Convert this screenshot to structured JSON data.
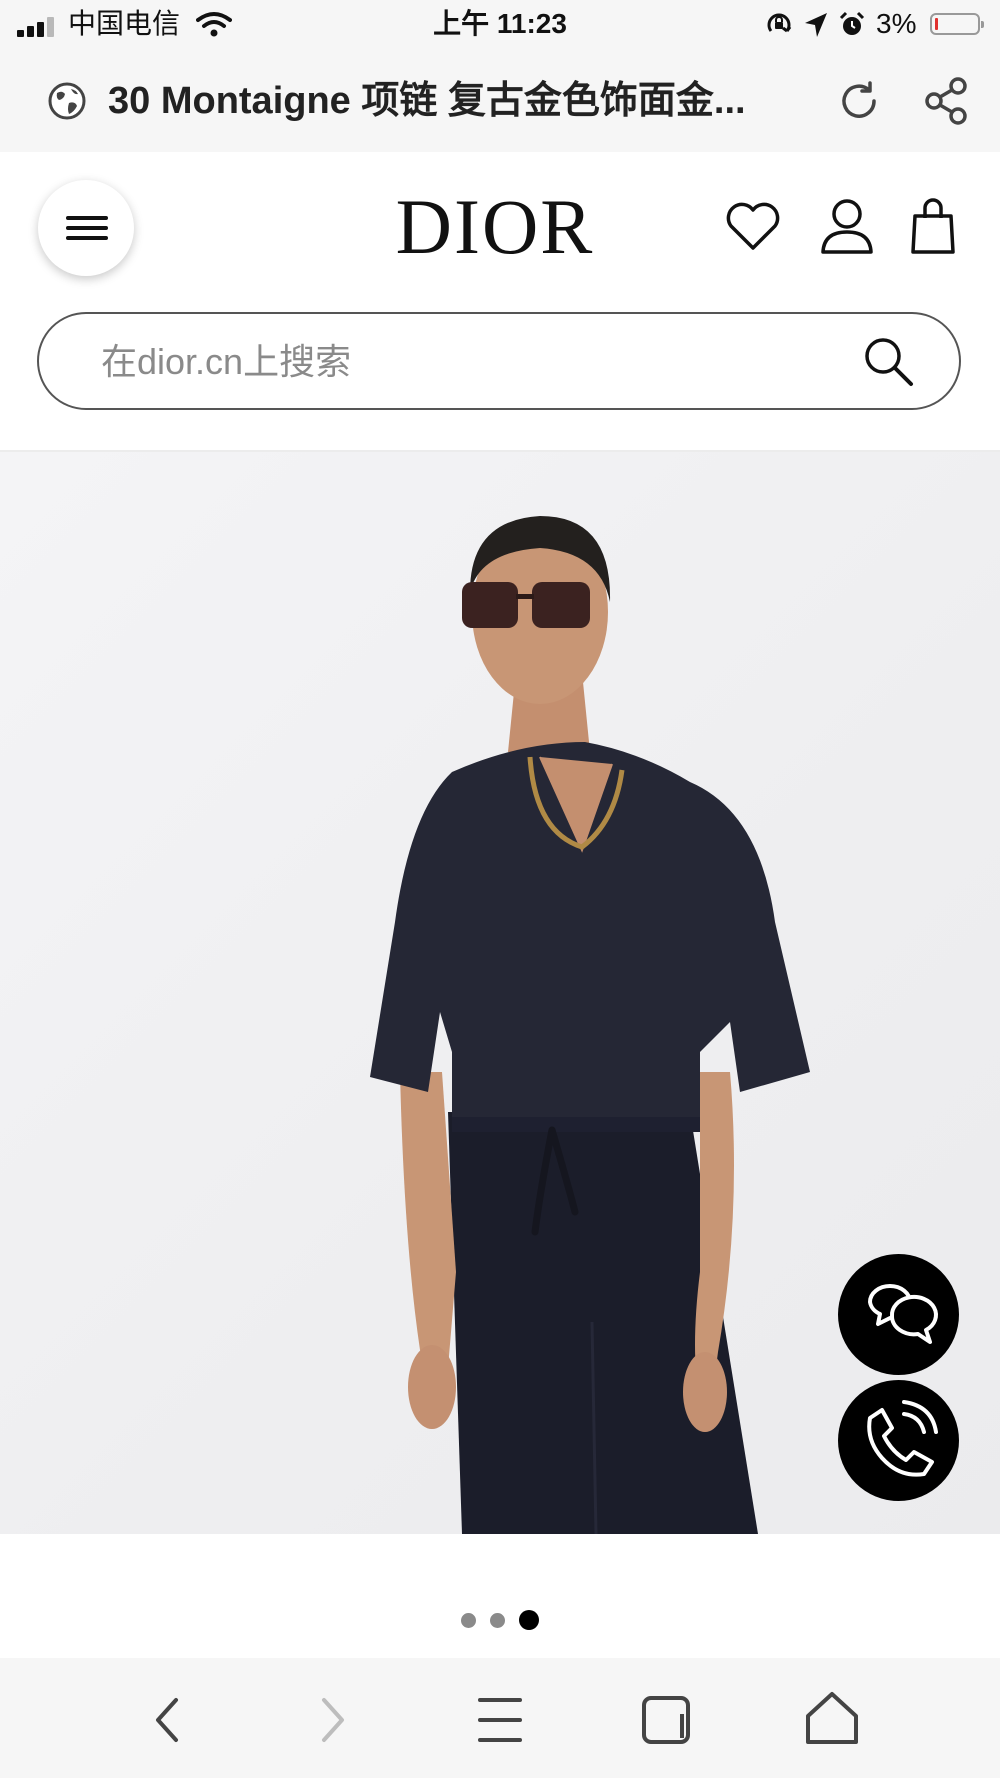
{
  "status_bar": {
    "carrier": "中国电信",
    "time": "上午 11:23",
    "battery_percent": "3%",
    "battery_level": 0.03,
    "icons": [
      "signal-icon",
      "wifi-icon",
      "rotation-lock-icon",
      "location-icon",
      "alarm-icon",
      "battery-icon"
    ]
  },
  "browser": {
    "page_title": "30 Montaigne 项链 复古金色饰面金...",
    "icons": [
      "globe-icon",
      "reload-icon",
      "share-icon"
    ]
  },
  "site_header": {
    "logo": "DIOR",
    "icons": [
      "menu-icon",
      "heart-icon",
      "user-icon",
      "bag-icon"
    ],
    "search": {
      "placeholder": "在dior.cn上搜索",
      "value": ""
    }
  },
  "product": {
    "image": "model-photo",
    "floating_buttons": [
      "chat-icon",
      "phone-icon"
    ],
    "carousel": {
      "total": 3,
      "active_index": 2
    }
  },
  "bottom_nav": {
    "icons": [
      "back-icon",
      "forward-icon",
      "menu-icon",
      "tabs-icon",
      "home-icon"
    ]
  },
  "colors": {
    "status_bg": "#f6f6f6",
    "text": "#111111",
    "battery_low": "#e0312f",
    "fab_bg": "#000000",
    "image_bg": "#f0f0f2"
  }
}
